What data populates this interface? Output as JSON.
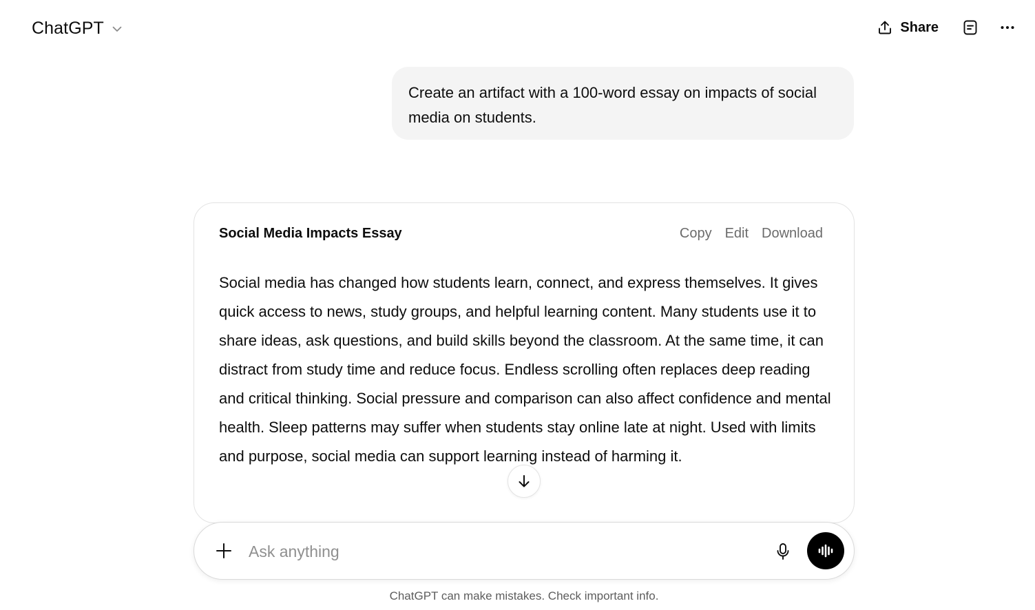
{
  "header": {
    "app_title": "ChatGPT",
    "model_menu_icon": "chevron-down-icon",
    "share_label": "Share",
    "share_icon": "upload-icon",
    "canvas_icon": "document-icon",
    "more_icon": "more-horizontal-icon"
  },
  "conversation": {
    "user_message": "Create an artifact with a 100-word essay on impacts of social media on students.",
    "artifact": {
      "title": "Social Media Impacts Essay",
      "actions": {
        "copy": "Copy",
        "edit": "Edit",
        "download": "Download"
      },
      "content": "Social media has changed how students learn, connect, and express themselves. It gives quick access to news, study groups, and helpful learning content. Many students use it to share ideas, ask questions, and build skills beyond the classroom. At the same time, it can distract from study time and reduce focus. Endless scrolling often replaces deep reading and critical thinking. Social pressure and comparison can also affect confidence and mental health. Sleep patterns may suffer when students stay online late at night. Used with limits and purpose, social media can support learning instead of harming it."
    },
    "scroll_down_icon": "arrow-down-icon"
  },
  "composer": {
    "placeholder": "Ask anything",
    "value": "",
    "add_icon": "plus-icon",
    "mic_icon": "microphone-icon",
    "voice_icon": "voice-waveform-icon"
  },
  "footer": {
    "disclaimer": "ChatGPT can make mistakes. Check important info."
  },
  "colors": {
    "user_bubble_bg": "#f4f4f4",
    "voice_button_bg": "#000000",
    "muted_text": "#6b6b6b",
    "border": "#e3e3e3"
  }
}
